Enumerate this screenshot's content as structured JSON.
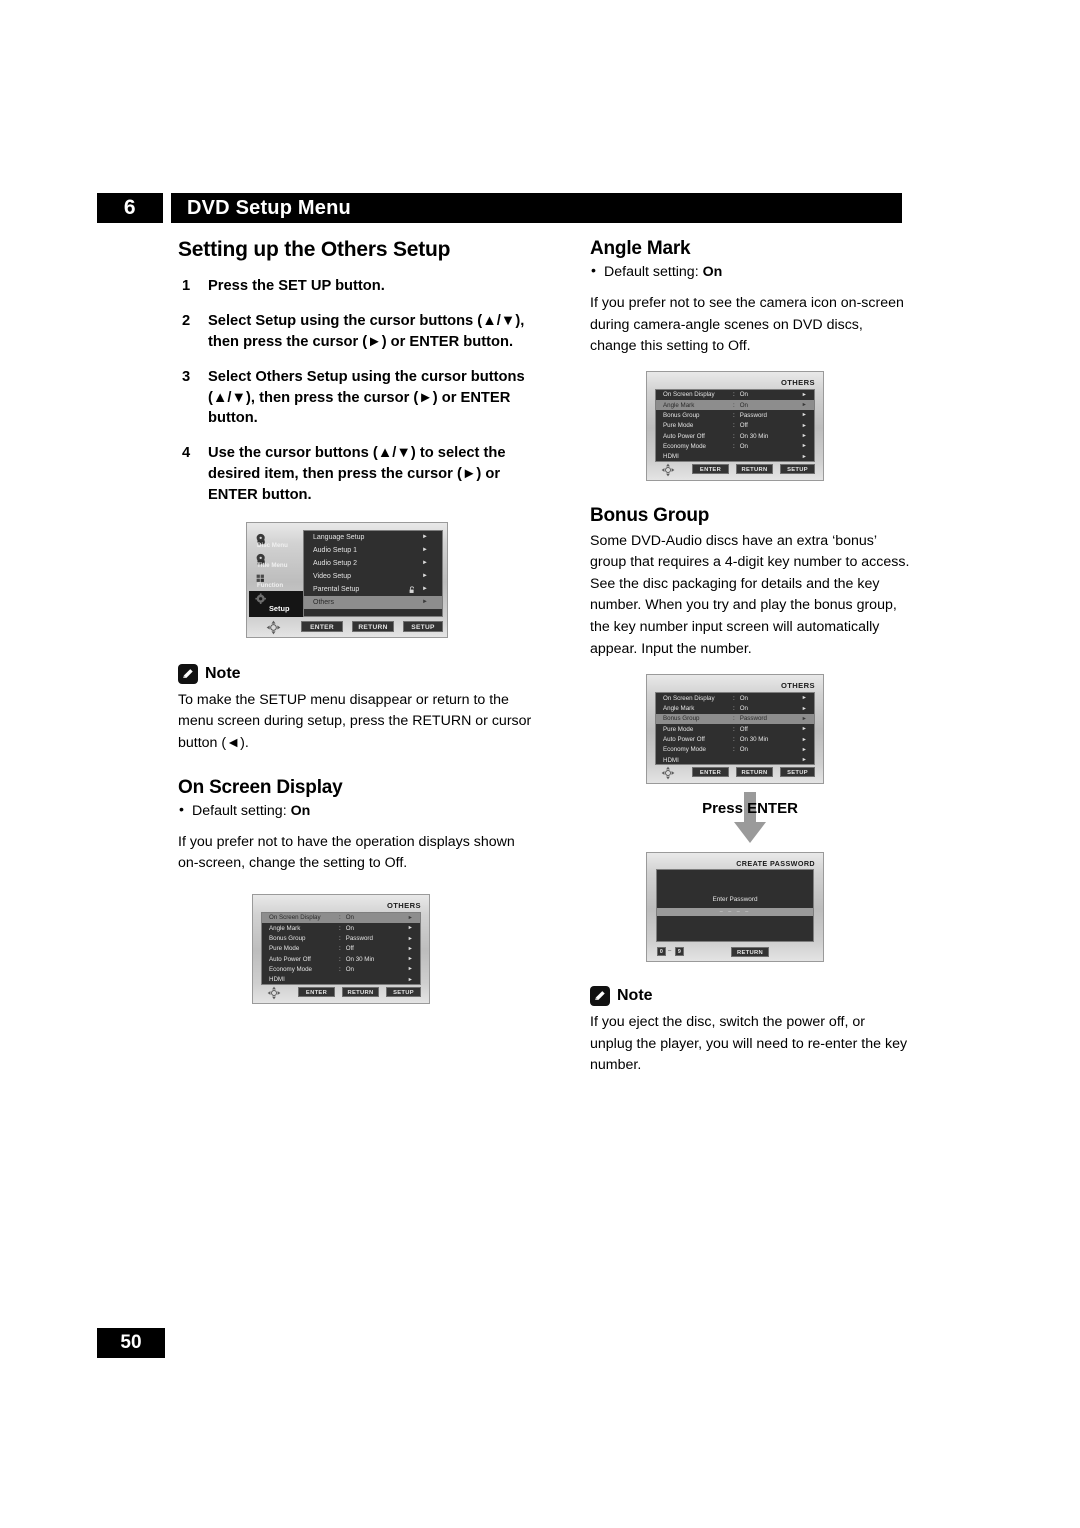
{
  "header": {
    "chapter_number": "6",
    "chapter_title": "DVD Setup Menu"
  },
  "footer": {
    "page_number": "50"
  },
  "left_column": {
    "section_title": "Setting up the Others Setup",
    "steps": [
      {
        "num": "1",
        "text": "Press the SET UP button."
      },
      {
        "num": "2",
        "text": "Select Setup using the cursor buttons (▲/▼), then press the cursor (►) or ENTER button."
      },
      {
        "num": "3",
        "text": "Select Others Setup using the cursor buttons (▲/▼), then press the cursor (►) or ENTER button."
      },
      {
        "num": "4",
        "text": "Use the cursor buttons (▲/▼) to select the desired item, then press the cursor (►) or ENTER button."
      }
    ],
    "note": {
      "label": "Note",
      "text": "To make the SETUP menu disappear or return to the menu screen during setup, press the RETURN or cursor button (◄)."
    },
    "on_screen_display": {
      "title": "On Screen Display",
      "default_setting_label": "Default setting:",
      "default_setting_value": "On",
      "body": "If you prefer not to have the operation displays shown on-screen, change the setting to Off."
    }
  },
  "right_column": {
    "angle_mark": {
      "title": "Angle Mark",
      "default_setting_label": "Default setting:",
      "default_setting_value": "On",
      "body": "If you prefer not to see the camera icon on-screen during camera-angle scenes on DVD discs, change this setting to Off."
    },
    "bonus_group": {
      "title": "Bonus Group",
      "body": "Some DVD-Audio discs have an extra ‘bonus’ group that requires a 4-digit key number to access. See the disc packaging for details and the key number. When you try and play the bonus group, the key number input screen will automatically appear. Input the number."
    },
    "press_enter_label": "Press ENTER",
    "note": {
      "label": "Note",
      "text": "If you eject the disc, switch the power off, or unplug the player, you will need to re-enter the key number."
    }
  },
  "setup_menu_screen": {
    "sidebar": [
      {
        "label": "Disc Menu",
        "icon": "disc-menu-icon",
        "active": false
      },
      {
        "label": "Title Menu",
        "icon": "title-menu-icon",
        "active": false
      },
      {
        "label": "Function",
        "icon": "function-icon",
        "active": false
      },
      {
        "label": "Setup",
        "icon": "setup-gear-icon",
        "active": true
      }
    ],
    "rows": [
      {
        "label": "Language Setup",
        "value": "",
        "selected": false,
        "lock_icon": false
      },
      {
        "label": "Audio Setup 1",
        "value": "",
        "selected": false,
        "lock_icon": false
      },
      {
        "label": "Audio Setup 2",
        "value": "",
        "selected": false,
        "lock_icon": false
      },
      {
        "label": "Video Setup",
        "value": "",
        "selected": false,
        "lock_icon": false
      },
      {
        "label": "Parental Setup",
        "value": "",
        "selected": false,
        "lock_icon": true
      },
      {
        "label": "Others",
        "value": "",
        "selected": true,
        "lock_icon": false
      }
    ],
    "buttons": [
      "ENTER",
      "RETURN",
      "SETUP"
    ]
  },
  "others_menu": {
    "screen_title": "OTHERS",
    "rows": [
      {
        "label": "On Screen Display",
        "value": "On"
      },
      {
        "label": "Angle Mark",
        "value": "On"
      },
      {
        "label": "Bonus Group",
        "value": "Password"
      },
      {
        "label": "Pure Mode",
        "value": "Off"
      },
      {
        "label": "Auto Power Off",
        "value": "On 30 Min"
      },
      {
        "label": "Economy Mode",
        "value": "On"
      },
      {
        "label": "HDMI",
        "value": ""
      }
    ],
    "buttons": [
      "ENTER",
      "RETURN",
      "SETUP"
    ],
    "selected_index_osd": 0,
    "selected_index_angle": 1,
    "selected_index_bonus": 2
  },
  "password_screen": {
    "screen_title": "CREATE PASSWORD",
    "prompt": "Enter Password",
    "entry_mask": "– – – –",
    "numeric_hint_from": "0",
    "numeric_hint_dash": "–",
    "numeric_hint_to": "9",
    "return_button": "RETURN"
  },
  "colors": {
    "ink": "#000000",
    "paper": "#ffffff",
    "panel_bg": "#2f2f2f",
    "panel_selected": "#8d8d8d",
    "bezel_light": "#e9e9e9",
    "bezel_dark": "#bdbdbd"
  }
}
